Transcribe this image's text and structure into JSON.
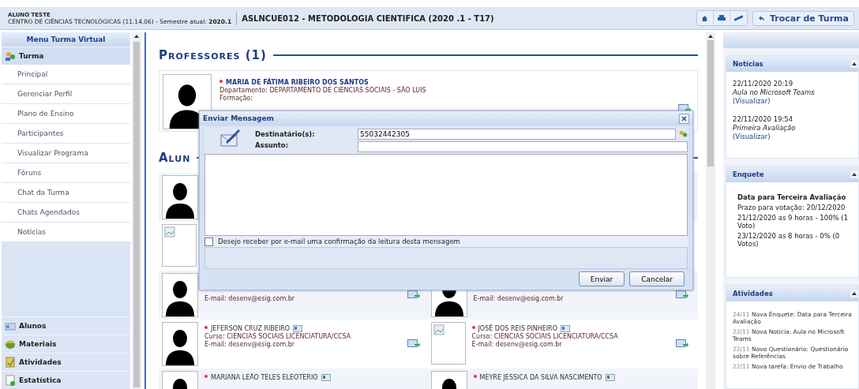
{
  "header": {
    "user": "ALUNO TESTE",
    "unit": "CENTRO DE CIÊNCIAS TECNOLÓGICAS (11.14.06) - Semestre atual: **2020.1**",
    "course_title": "ASLNCUE012 - METODOLOGIA CIENTIFICA (2020 .1 - T17)",
    "switch_button": "Trocar de Turma"
  },
  "sidebar": {
    "title": "Menu Turma Virtual",
    "groups": [
      {
        "label": "Turma",
        "items": [
          {
            "label": "Principal"
          },
          {
            "label": "Gerenciar Perfil"
          },
          {
            "label": "Plano de Ensino"
          },
          {
            "label": "Participantes"
          },
          {
            "label": "Visualizar Programa"
          },
          {
            "label": "Fóruns"
          },
          {
            "label": "Chat da Turma"
          },
          {
            "label": "Chats Agendados"
          },
          {
            "label": "Notícias"
          }
        ]
      },
      {
        "label": "Alunos"
      },
      {
        "label": "Materiais"
      },
      {
        "label": "Atividades"
      },
      {
        "label": "Estatística"
      }
    ]
  },
  "professors": {
    "heading": "Professores (1)",
    "items": [
      {
        "name": "MARIA DE FÁTIMA RIBEIRO DOS SANTOS",
        "department": "Departamento: DEPARTAMENTO DE CIENCIAS SOCIAIS - SÃO LUIS",
        "formation": "Formação:"
      }
    ]
  },
  "students": {
    "heading": "Alun",
    "rows": [
      [
        {
          "kind": "avatar"
        }
      ],
      [
        {
          "kind": "broken"
        }
      ],
      [
        {
          "kind": "avatar",
          "email": "E-mail: desenv@esig.com.br"
        },
        {
          "kind": "avatar",
          "email": "E-mail: desenv@esig.com.br"
        }
      ],
      [
        {
          "kind": "avatar",
          "name": "JEFERSON CRUZ RIBEIRO",
          "course": "Curso: CIENCIAS SOCIAIS LICENCIATURA/CCSA",
          "email": "E-mail: desenv@esig.com.br"
        },
        {
          "kind": "broken",
          "name": "JOSÉ DOS REIS PINHEIRO",
          "course": "Curso: CIENCIAS SOCIAIS LICENCIATURA/CCSA",
          "email": "E-mail: desenv@esig.com.br"
        }
      ],
      [
        {
          "kind": "avatar",
          "name": "MARIANA LEÃO TELES ELEOTERIO"
        },
        {
          "kind": "avatar",
          "name": "MEYRE JESSICA DA SILVA NASCIMENTO"
        }
      ]
    ]
  },
  "dialog": {
    "title": "Enviar Mensagem",
    "recipients_label": "Destinatário(s):",
    "recipients_value": "55032442305",
    "subject_label": "Assunto:",
    "read_receipt": {
      "label": "Desejo receber por e-mail uma confirmação da leitura desta mensagem",
      "checked": false
    },
    "buttons": [
      "Enviar",
      "Cancelar"
    ]
  },
  "right_panel": {
    "news": {
      "title": "Notícias",
      "items": [
        {
          "datetime": "22/11/2020 20:19",
          "title": "Aula no Microsoft Teams",
          "link": "(Visualizar)"
        },
        {
          "datetime": "22/11/2020 19:54",
          "title": "Primeira Avaliação",
          "link": "(Visualizar)"
        }
      ]
    },
    "poll": {
      "title": "Enquete",
      "question": "Data para Terceira Avaliação",
      "deadline": "Prazo para votação: 20/12/2020",
      "options": [
        "21/12/2020 as 9 horas - 100% (1 Voto)",
        "23/12/2020 as 8 horas - 0% (0 Votos)"
      ]
    },
    "activities": {
      "title": "Atividades",
      "items": [
        {
          "date": "24/11",
          "text": "Nova Enquete: Data para Terceira Avaliação"
        },
        {
          "date": "22/11",
          "text": "Nova Notícia: Aula no Microsoft Teams"
        },
        {
          "date": "22/11",
          "text": "Novo Questionário: Questionário sobre Referências"
        },
        {
          "date": "22/11",
          "text": "Nova tarefa: Envio de Trabalho"
        }
      ]
    }
  }
}
